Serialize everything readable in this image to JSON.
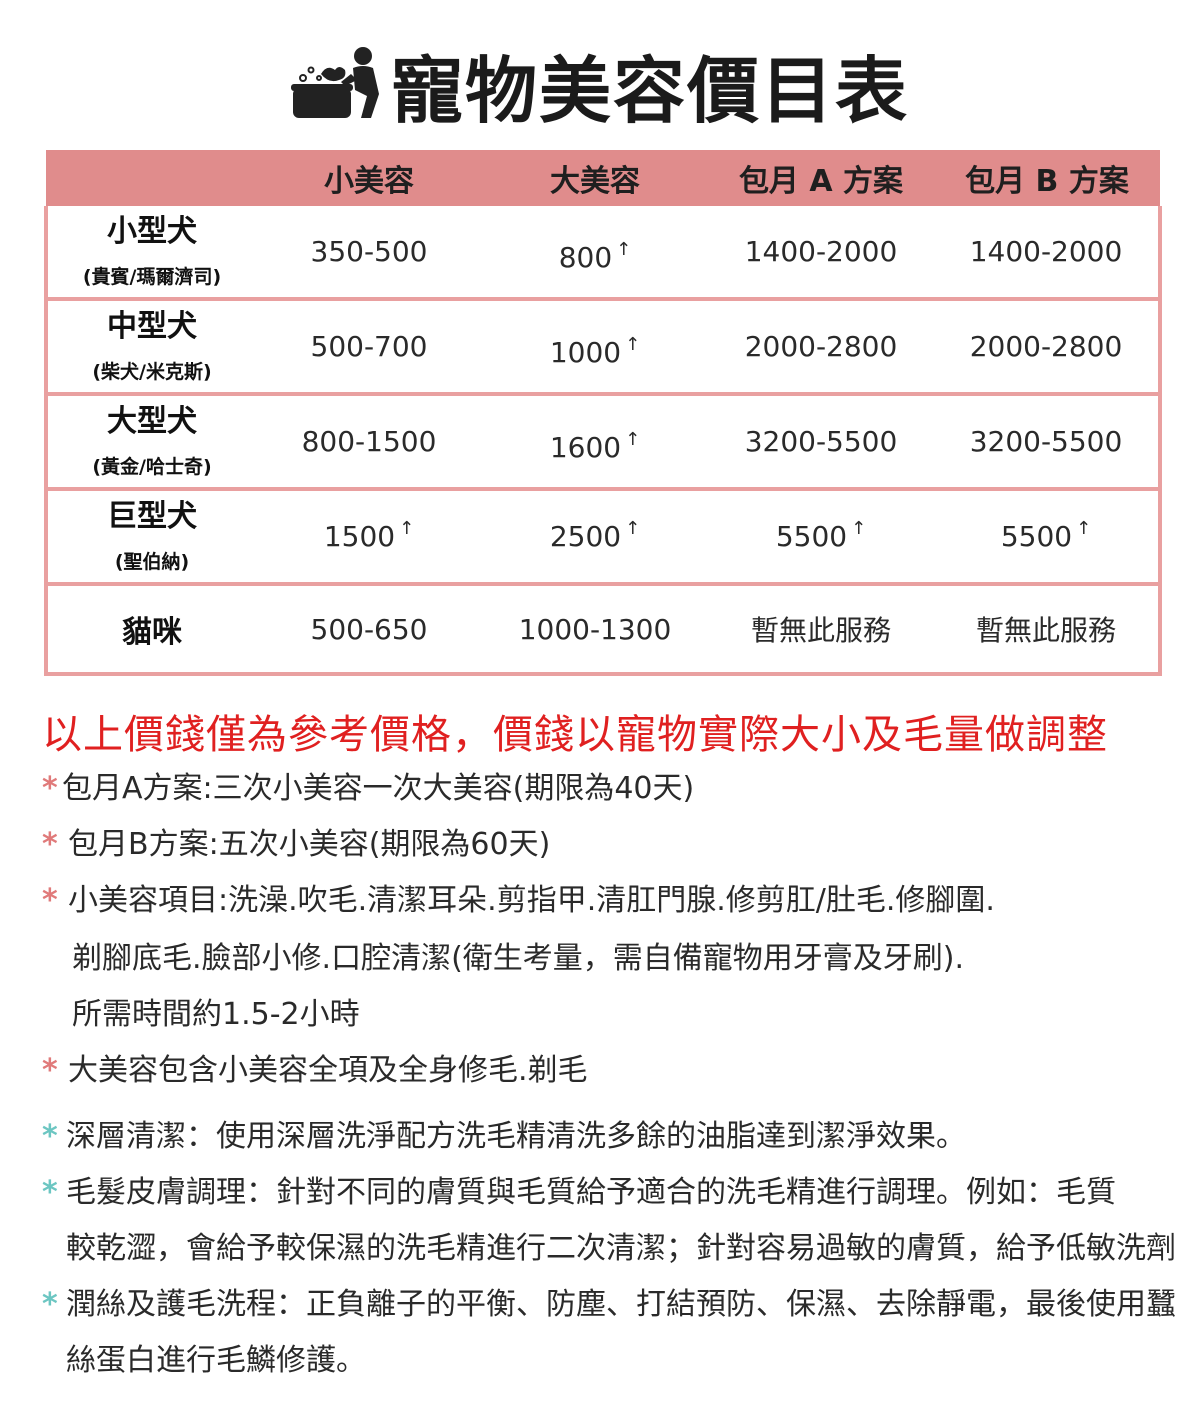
{
  "title": "寵物美容價目表",
  "icons": {
    "title": "pet-bath-icon"
  },
  "colors": {
    "header_bg": "#e08c8c",
    "border": "#e9a0a0",
    "notice": "#e02020",
    "star_pink": "#e07a7a",
    "star_teal": "#6cc6c2"
  },
  "table": {
    "headers": [
      "",
      "小美容",
      "大美容",
      "包月 A 方案",
      "包月 B 方案"
    ],
    "rows": [
      {
        "name": "小型犬",
        "sub": "(貴賓/瑪爾濟司)",
        "cells": [
          "350-500",
          "800",
          "1400-2000",
          "1400-2000"
        ]
      },
      {
        "name": "中型犬",
        "sub": "(柴犬/米克斯)",
        "cells": [
          "500-700",
          "1000",
          "2000-2800",
          "2000-2800"
        ]
      },
      {
        "name": "大型犬",
        "sub": "(黃金/哈士奇)",
        "cells": [
          "800-1500",
          "1600",
          "3200-5500",
          "3200-5500"
        ]
      },
      {
        "name": "巨型犬",
        "sub": "(聖伯納)",
        "cells": [
          "1500",
          "2500",
          "5500",
          "5500"
        ]
      },
      {
        "name": "貓咪",
        "sub": "",
        "cells": [
          "500-650",
          "1000-1300",
          "暫無此服務",
          "暫無此服務"
        ]
      }
    ],
    "arrow": "↑"
  },
  "notice": "以上價錢僅為參考價格，價錢以寵物實際大小及毛量做調整",
  "star": "*",
  "notes": [
    "包月A方案:三次小美容一次大美容(期限為40天)",
    "包月B方案:五次小美容(期限為60天)",
    "小美容項目:洗澡.吹毛.清潔耳朵.剪指甲.清肛門腺.修剪肛/肚毛.修腳圍.",
    "剃腳底毛.臉部小修.口腔清潔(衛生考量，需自備寵物用牙膏及牙刷).",
    "所需時間約1.5-2小時",
    "大美容包含小美容全項及全身修毛.剃毛",
    "深層清潔：使用深層洗淨配方洗毛精清洗多餘的油脂達到潔淨效果。",
    "毛髮皮膚調理：針對不同的膚質與毛質給予適合的洗毛精進行調理。例如：毛質",
    "較乾澀，會給予較保濕的洗毛精進行二次清潔；針對容易過敏的膚質，給予低敏洗劑",
    "潤絲及護毛洗程：正負離子的平衡、防塵、打結預防、保濕、去除靜電，最後使用蠶",
    "絲蛋白進行毛鱗修護。"
  ]
}
